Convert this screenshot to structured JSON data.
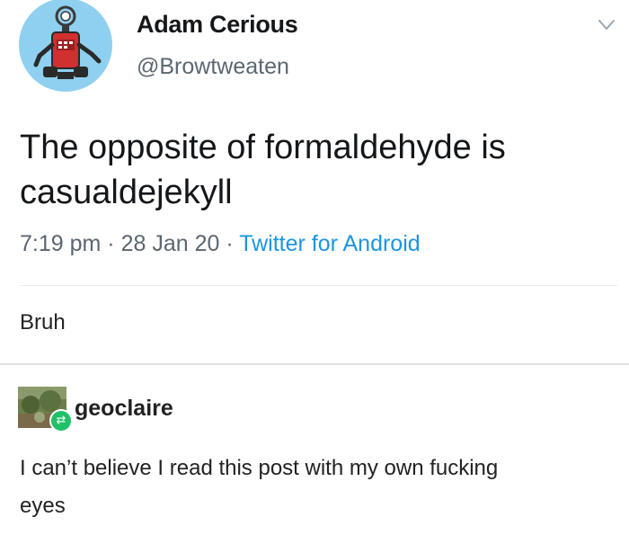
{
  "tweet": {
    "author_name": "Adam Cerious",
    "author_handle": "@Browtweaten",
    "text_line_1": "The opposite of formaldehyde is",
    "text_line_2": "casualdejekyll",
    "time": "7:19 pm",
    "date": "28 Jan 20",
    "source": "Twitter for Android",
    "separator": "·",
    "avatar_icon": "robot-avatar-icon",
    "menu_icon": "chevron-down-icon"
  },
  "reblog": {
    "caption": "Bruh"
  },
  "reply": {
    "username": "geoclaire",
    "text_line_1": "I can’t believe I read this post with my own fucking",
    "text_line_2": "eyes",
    "badge_icon": "reblog-icon"
  },
  "colors": {
    "link": "#1b95e0",
    "secondary_text": "#5b6670",
    "avatar_bg": "#8fd0f0",
    "reblog_badge": "#21c169"
  }
}
